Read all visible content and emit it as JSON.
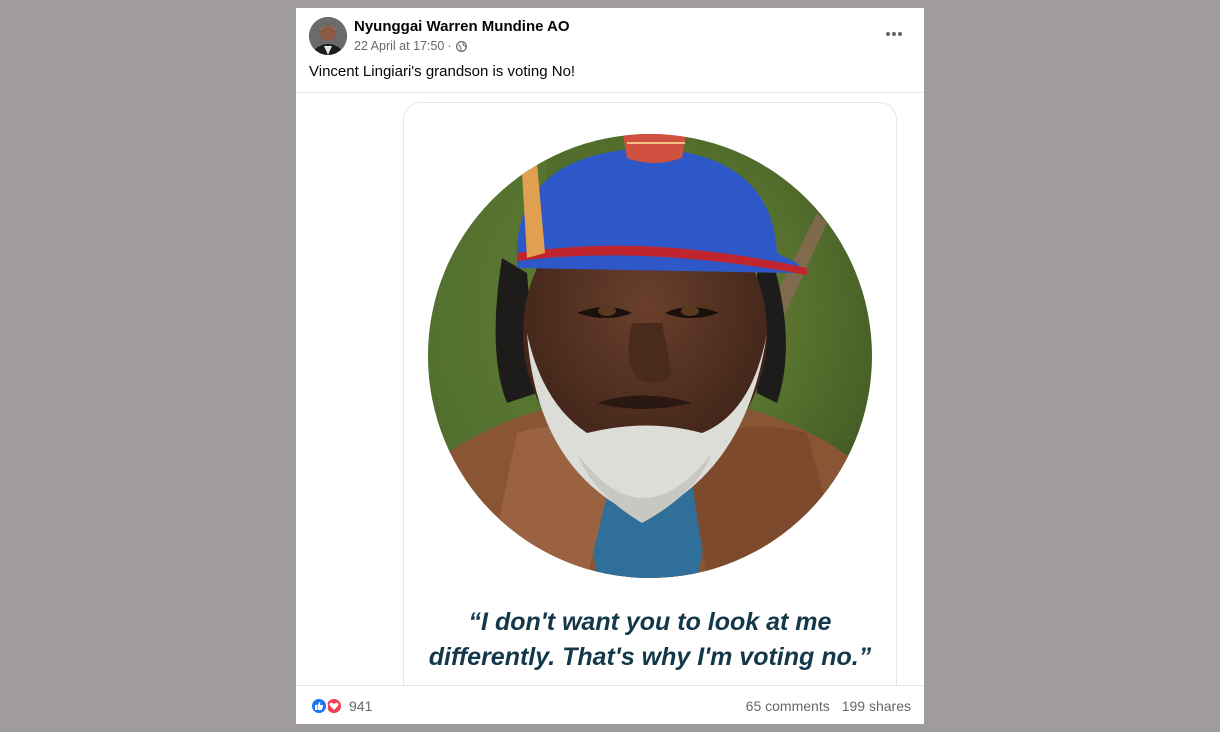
{
  "post": {
    "author": "Nyunggai Warren Mundine AO",
    "date": "22 April at 17:50",
    "separator": "·",
    "audience_icon": "globe-icon",
    "more_icon": "more-options-icon",
    "caption": "Vincent Lingiari's grandson is voting No!",
    "image": {
      "quote_line1": "“I don't want you to look at me",
      "quote_line2": "differently. That's why I'm voting no.”"
    },
    "reactions": {
      "icons": [
        "like-icon",
        "love-icon"
      ],
      "count": "941"
    },
    "comments": "65 comments",
    "shares": "199 shares"
  },
  "colors": {
    "background": "#a09c9c",
    "quote_text": "#14384a",
    "like_blue": "#1877f2",
    "love_red": "#f33e58",
    "secondary_text": "#65676b"
  }
}
